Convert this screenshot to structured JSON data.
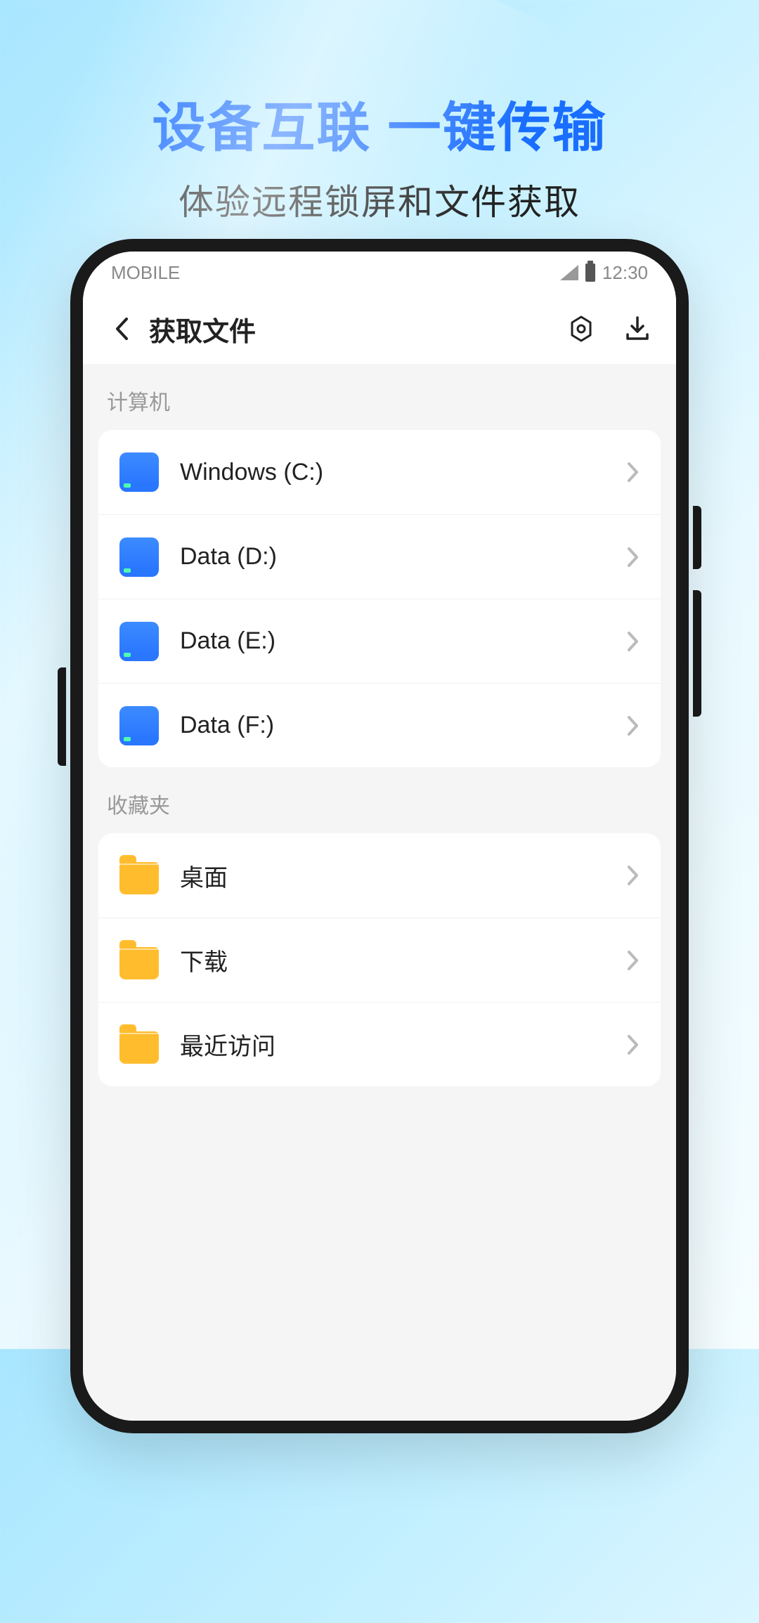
{
  "headline": {
    "title": "设备互联 一键传输",
    "subtitle": "体验远程锁屏和文件获取"
  },
  "statusBar": {
    "carrier": "MOBILE",
    "time": "12:30"
  },
  "appHeader": {
    "title": "获取文件"
  },
  "sections": {
    "computer": {
      "label": "计算机",
      "items": [
        {
          "label": "Windows (C:)"
        },
        {
          "label": "Data (D:)"
        },
        {
          "label": "Data (E:)"
        },
        {
          "label": "Data (F:)"
        }
      ]
    },
    "favorites": {
      "label": "收藏夹",
      "items": [
        {
          "label": "桌面"
        },
        {
          "label": "下载"
        },
        {
          "label": "最近访问"
        }
      ]
    }
  }
}
